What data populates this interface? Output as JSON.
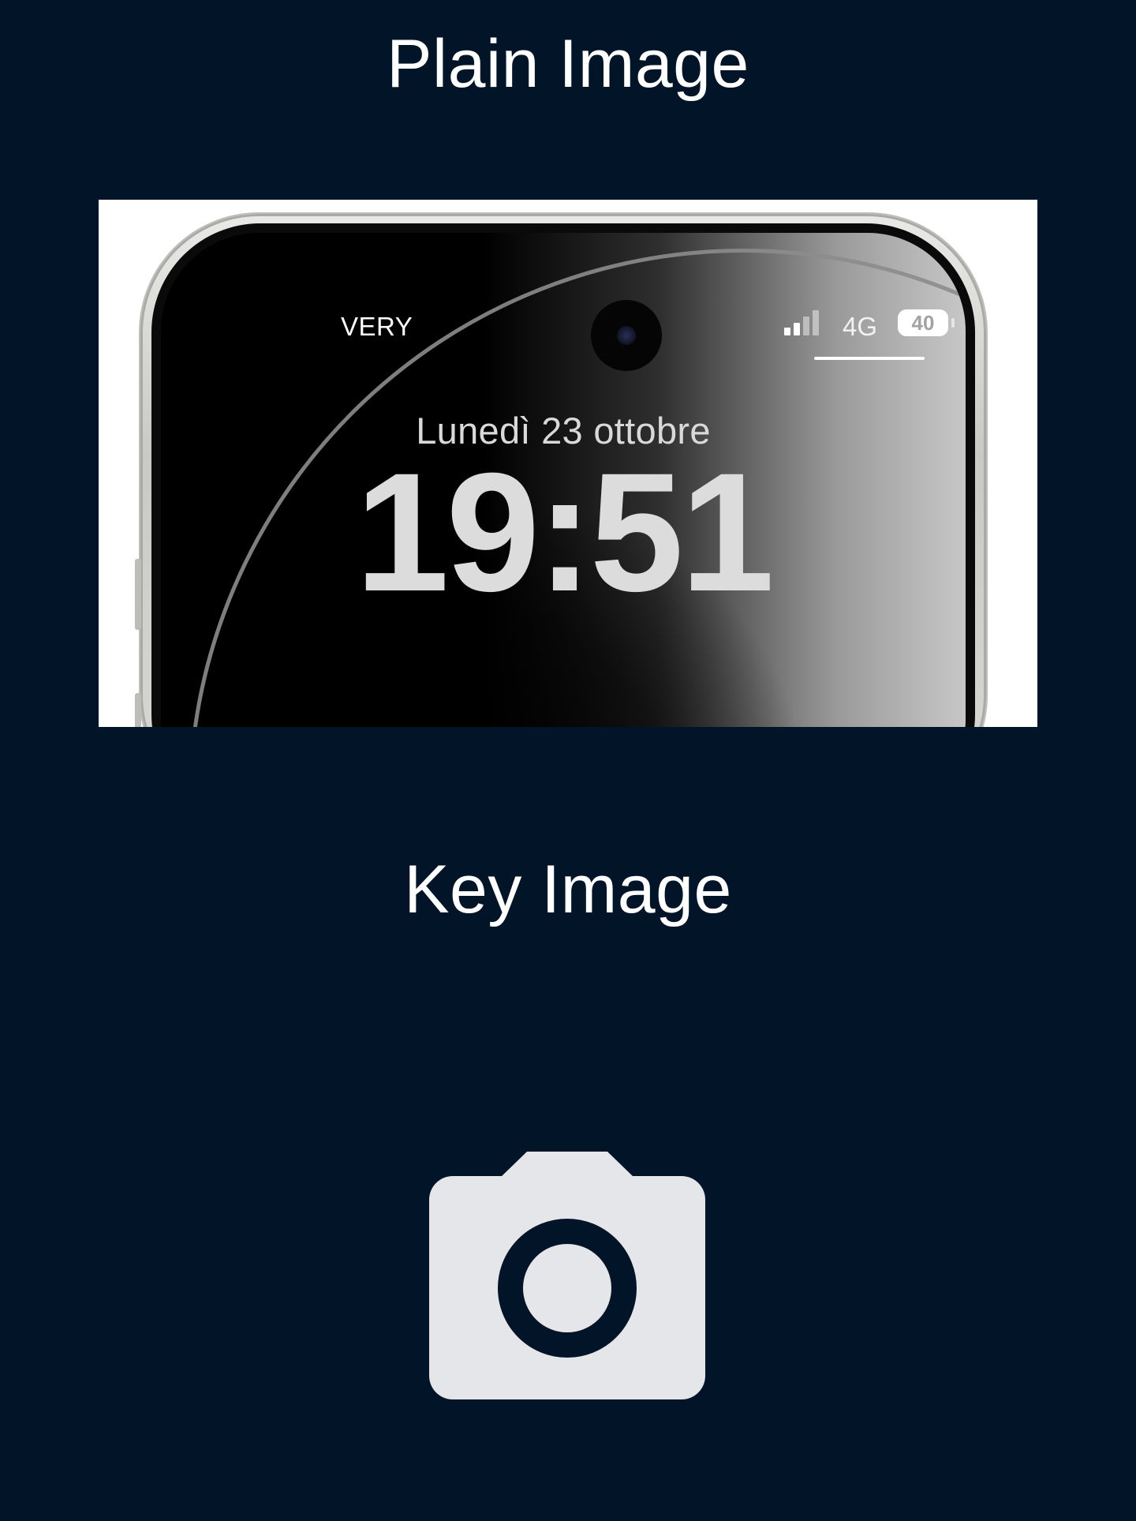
{
  "plain_image": {
    "title": "Plain Image",
    "phone": {
      "carrier": "VERY",
      "network": "4G",
      "battery": "40",
      "date": "Lunedì 23 ottobre",
      "time": "19:51"
    }
  },
  "key_image": {
    "title": "Key Image",
    "icon": "camera-icon"
  },
  "colors": {
    "background": "#011428",
    "title_text": "#ffffff",
    "icon_fill": "#e5e6e9"
  }
}
